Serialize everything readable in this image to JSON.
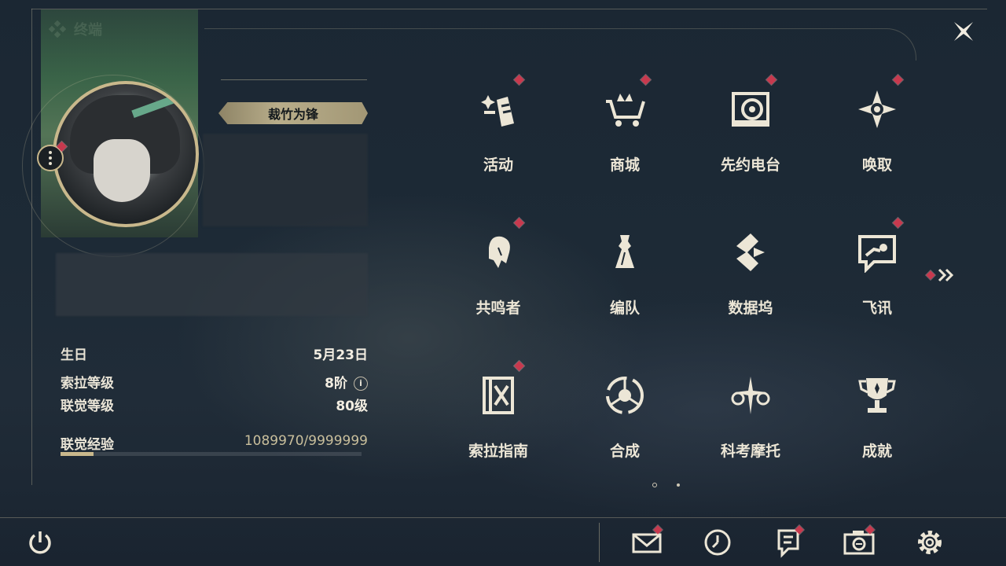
{
  "header": {
    "title": "终端"
  },
  "profile": {
    "name": "裁竹为锋",
    "info": [
      {
        "label": "生日",
        "value": "5月23日"
      },
      {
        "label": "索拉等级",
        "value": "8阶"
      },
      {
        "label": "联觉等级",
        "value": "80级"
      }
    ],
    "exp": {
      "label": "联觉经验",
      "value": "1089970/9999999",
      "fraction": 0.109
    }
  },
  "menu": {
    "items": [
      {
        "label": "活动",
        "icon": "event-sparkle-icon",
        "badge": true
      },
      {
        "label": "商城",
        "icon": "shop-cart-icon",
        "badge": true
      },
      {
        "label": "先约电台",
        "icon": "radio-icon",
        "badge": true
      },
      {
        "label": "唤取",
        "icon": "summon-compass-icon",
        "badge": true
      },
      {
        "label": "共鸣者",
        "icon": "resonator-head-icon",
        "badge": true
      },
      {
        "label": "编队",
        "icon": "team-chess-icon",
        "badge": false
      },
      {
        "label": "数据坞",
        "icon": "data-dock-icon",
        "badge": false
      },
      {
        "label": "飞讯",
        "icon": "message-icon",
        "badge": true
      },
      {
        "label": "索拉指南",
        "icon": "guide-book-icon",
        "badge": true
      },
      {
        "label": "合成",
        "icon": "synthesis-icon",
        "badge": false
      },
      {
        "label": "科考摩托",
        "icon": "motorcycle-icon",
        "badge": false
      },
      {
        "label": "成就",
        "icon": "trophy-icon",
        "badge": false
      }
    ],
    "page": {
      "current": 1,
      "total": 2
    }
  },
  "bottom": {
    "buttons": [
      {
        "icon": "mail-icon",
        "badge": true
      },
      {
        "icon": "clock-icon",
        "badge": false
      },
      {
        "icon": "notes-icon",
        "badge": true
      },
      {
        "icon": "camera-icon",
        "badge": true
      },
      {
        "icon": "settings-gear-icon",
        "badge": false
      }
    ]
  },
  "colors": {
    "accent": "#c9b88c",
    "badge": "#c8394e",
    "text": "#ece6d6"
  }
}
